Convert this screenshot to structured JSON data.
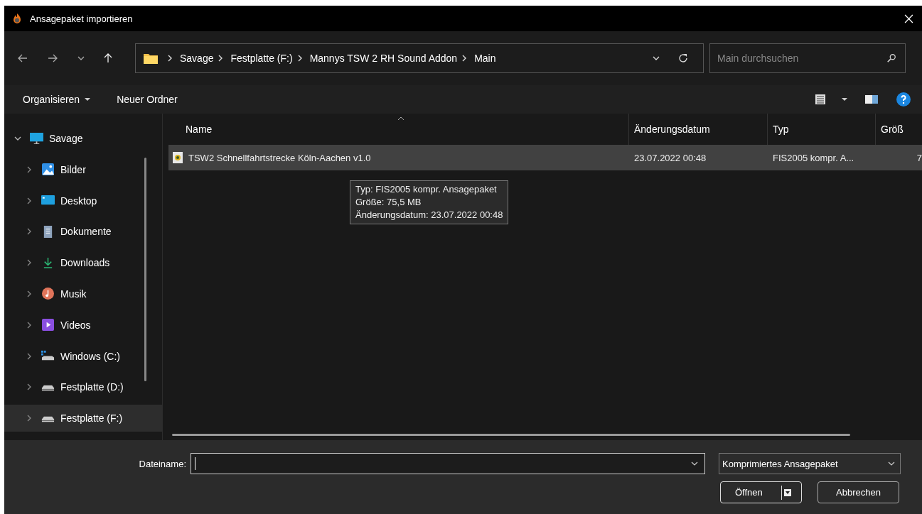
{
  "window": {
    "title": "Ansagepaket importieren"
  },
  "navigation": {
    "breadcrumbs": [
      "Savage",
      "Festplatte (F:)",
      "Mannys TSW 2 RH Sound Addon",
      "Main"
    ],
    "search": {
      "placeholder": "Main durchsuchen"
    }
  },
  "toolbar": {
    "organize": "Organisieren",
    "new_folder": "Neuer Ordner"
  },
  "sidebar": {
    "items": [
      {
        "label": "Savage",
        "kind": "pc",
        "expanded": true,
        "selected": false,
        "children": [
          {
            "label": "Bilder",
            "kind": "pictures",
            "expanded": false,
            "selected": false
          },
          {
            "label": "Desktop",
            "kind": "desktop",
            "expanded": false,
            "selected": false
          },
          {
            "label": "Dokumente",
            "kind": "documents",
            "expanded": false,
            "selected": false
          },
          {
            "label": "Downloads",
            "kind": "downloads",
            "expanded": false,
            "selected": false
          },
          {
            "label": "Musik",
            "kind": "music",
            "expanded": false,
            "selected": false
          },
          {
            "label": "Videos",
            "kind": "videos",
            "expanded": false,
            "selected": false
          },
          {
            "label": "Windows (C:)",
            "kind": "windrive",
            "expanded": false,
            "selected": false
          },
          {
            "label": "Festplatte (D:)",
            "kind": "drive",
            "expanded": false,
            "selected": false
          },
          {
            "label": "Festplatte (F:)",
            "kind": "drive",
            "expanded": false,
            "selected": true
          }
        ]
      }
    ]
  },
  "file_list": {
    "columns": [
      "Name",
      "Änderungsdatum",
      "Typ",
      "Größ"
    ],
    "rows": [
      {
        "name": "TSW2 Schnellfahrtstrecke Köln-Aachen v1.0",
        "date": "23.07.2022 00:48",
        "type": "FIS2005 kompr. A...",
        "size": "7",
        "selected": true
      }
    ]
  },
  "tooltip": {
    "lines": [
      "Typ: FIS2005 kompr. Ansagepaket",
      "Größe: 75,5 MB",
      "Änderungsdatum: 23.07.2022 00:48"
    ]
  },
  "footer": {
    "filename_label": "Dateiname:",
    "filter": "Komprimiertes Ansagepaket",
    "open_button": "Öffnen",
    "cancel_button": "Abbrechen"
  }
}
